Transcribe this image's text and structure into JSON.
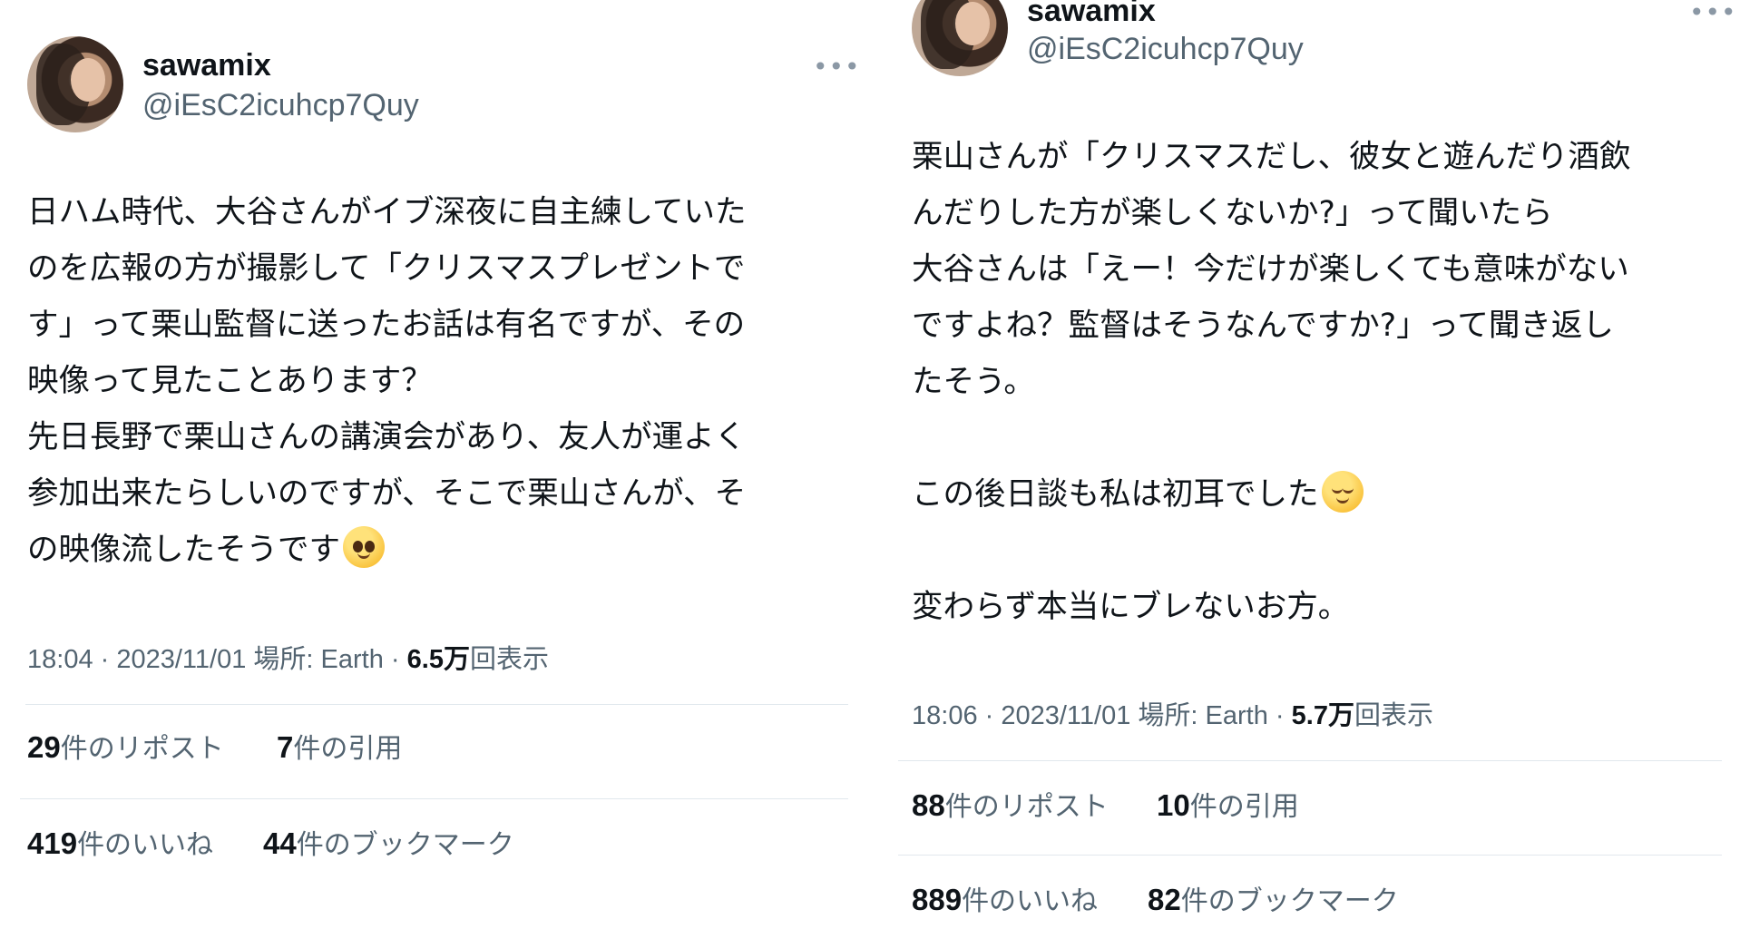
{
  "left": {
    "name": "sawamix",
    "handle": "@iEsC2icuhcp7Quy",
    "more": "•••",
    "text_lines": [
      "日ハム時代、大谷さんがイブ深夜に自主練していた",
      "のを広報の方が撮影して「クリスマスプレゼントで",
      "す」って栗山監督に送ったお話は有名ですが、その",
      "映像って見たことあります？",
      "先日長野で栗山さんの講演会があり、友人が運よく",
      "参加出来たらしいのですが、そこで栗山さんが、そ",
      "の映像流したそうです"
    ],
    "emoji": "pleading-face",
    "time": "18:04 · 2023/11/01",
    "place_label": "場所: Earth",
    "views_sep": "·",
    "views_count": "6.5万",
    "views_label": "回表示",
    "reposts_count": "29",
    "reposts_label": "件のリポスト",
    "quotes_count": "7",
    "quotes_label": "件の引用",
    "likes_count": "419",
    "likes_label": "件のいいね",
    "bookmarks_count": "44",
    "bookmarks_label": "件のブックマーク"
  },
  "right": {
    "name": "sawamix",
    "handle": "@iEsC2icuhcp7Quy",
    "more": "•••",
    "para1_lines": [
      "栗山さんが「クリスマスだし、彼女と遊んだり酒飲",
      "んだりした方が楽しくないか?」って聞いたら",
      "大谷さんは「えー！今だけが楽しくても意味がない",
      "ですよね？監督はそうなんですか?」って聞き返し",
      "たそう。"
    ],
    "para2": "この後日談も私は初耳でした",
    "emoji": "relieved-face",
    "para3": "変わらず本当にブレないお方。",
    "time": "18:06 · 2023/11/01",
    "place_label": "場所: Earth",
    "views_sep": "·",
    "views_count": "5.7万",
    "views_label": "回表示",
    "reposts_count": "88",
    "reposts_label": "件のリポスト",
    "quotes_count": "10",
    "quotes_label": "件の引用",
    "likes_count": "889",
    "likes_label": "件のいいね",
    "bookmarks_count": "82",
    "bookmarks_label": "件のブックマーク"
  }
}
